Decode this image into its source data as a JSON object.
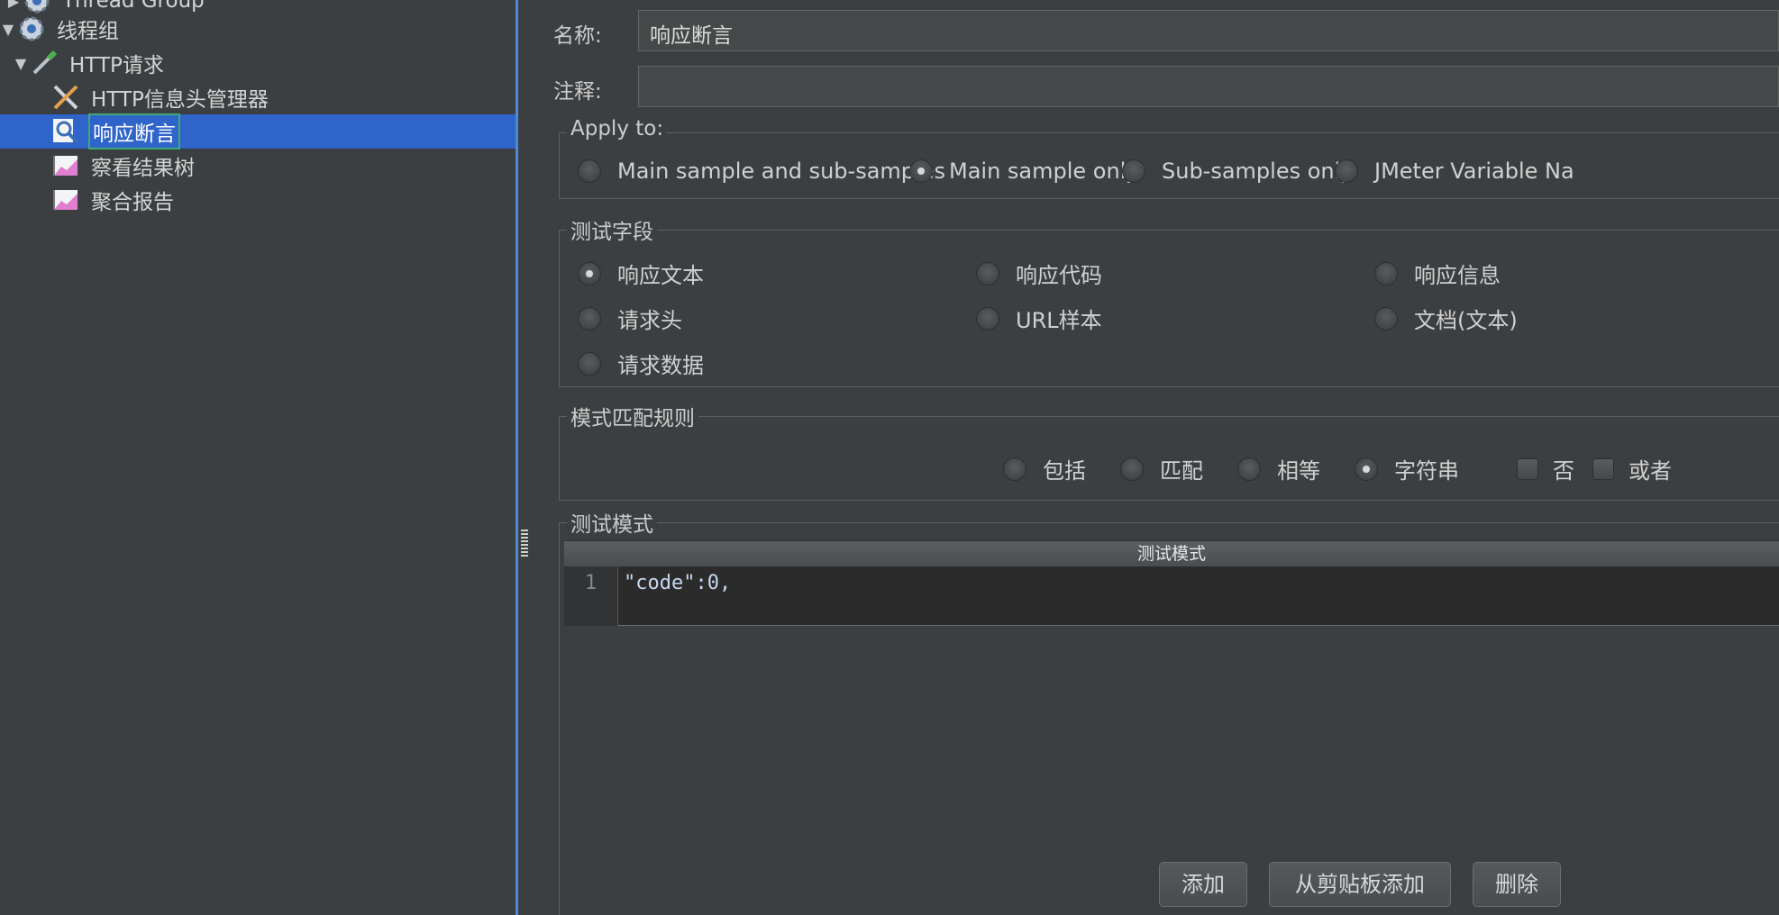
{
  "tree": {
    "items": [
      {
        "label": "Thread Group",
        "icon": "gear-icon"
      },
      {
        "label": "线程组",
        "icon": "gear-icon"
      },
      {
        "label": "HTTP请求",
        "icon": "pipette-icon"
      },
      {
        "label": "HTTP信息头管理器",
        "icon": "wrench-icon"
      },
      {
        "label": "响应断言",
        "icon": "magnifier-icon",
        "selected": true
      },
      {
        "label": "察看结果树",
        "icon": "chart-icon"
      },
      {
        "label": "聚合报告",
        "icon": "chart-icon"
      }
    ]
  },
  "editor": {
    "name_label": "名称:",
    "name_value": "响应断言",
    "comment_label": "注释:",
    "comment_value": "",
    "apply_to": {
      "title": "Apply to:",
      "options": [
        "Main sample and sub-samples",
        "Main sample only",
        "Sub-samples only",
        "JMeter Variable Na"
      ],
      "selected": "Main sample only"
    },
    "test_field": {
      "title": "测试字段",
      "options": [
        "响应文本",
        "响应代码",
        "响应信息",
        "请求头",
        "URL样本",
        "文档(文本)",
        "请求数据"
      ],
      "selected": "响应文本"
    },
    "pattern_rules": {
      "title": "模式匹配规则",
      "radios": [
        "包括",
        "匹配",
        "相等",
        "字符串"
      ],
      "selected": "字符串",
      "checks": [
        "否",
        "或者"
      ]
    },
    "test_patterns": {
      "title": "测试模式",
      "column_header": "测试模式",
      "rows": [
        {
          "line": "1",
          "text": "\"code\":0,"
        }
      ]
    },
    "buttons": {
      "add": "添加",
      "add_clipboard": "从剪贴板添加",
      "delete": "删除"
    }
  },
  "colors": {
    "background": "#3c3f41",
    "selection": "#2f65ca",
    "divider": "#4a8bd6"
  }
}
